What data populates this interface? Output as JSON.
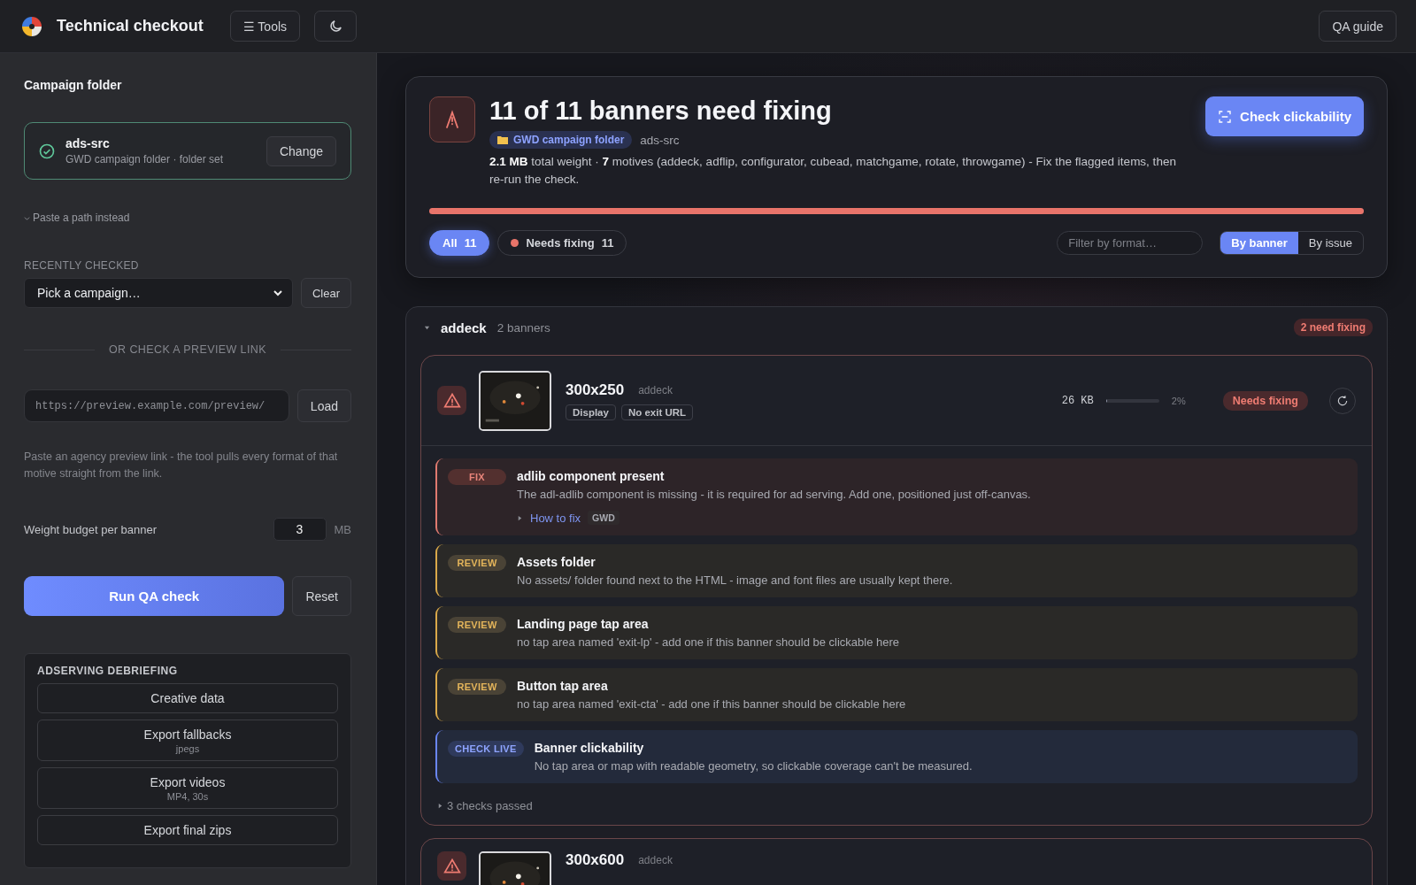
{
  "header": {
    "title": "Technical checkout",
    "tools_button": "☰ Tools",
    "guide_button": "QA guide"
  },
  "sidebar": {
    "folder_heading": "Campaign folder",
    "folder": {
      "name": "ads-src",
      "detail": "GWD campaign folder · folder set",
      "ok": true,
      "change_button": "Change"
    },
    "paste_link": "Paste a path instead",
    "recent_label": "RECENTLY CHECKED",
    "recent_select": "Pick a campaign…",
    "clear_button": "Clear",
    "divider_label": "OR CHECK A PREVIEW LINK",
    "url_placeholder": "https://preview.example.com/preview/",
    "load_button": "Load",
    "help": "Paste an agency preview link - the tool pulls every format of that motive straight from the link.",
    "budget_label": "Weight budget per banner",
    "budget_value": "3",
    "budget_unit": "MB",
    "run_button": "Run QA check",
    "reset_button": "Reset",
    "debrief": {
      "heading": "ADSERVING DEBRIEFING",
      "buttons": [
        {
          "label": "Creative data"
        },
        {
          "label": "Export fallbacks",
          "sub": "jpegs"
        },
        {
          "label": "Export videos",
          "sub": "MP4, 30s"
        },
        {
          "label": "Export final zips"
        }
      ]
    }
  },
  "summary": {
    "title": "11 of 11 banners need fixing",
    "folder_tag": "GWD campaign folder",
    "source": "ads-src",
    "text": "**2.1 MB** total weight · **7** motives (addeck, adflip, configurator, cubead, matchgame, rotate, throwgame) - Fix the flagged items, then re-run the check.",
    "check_button": "Check clickability",
    "progress": {
      "level": 1
    },
    "filters": [
      {
        "label": "All",
        "count": "11",
        "selected": true
      },
      {
        "label": "Needs fixing",
        "count": "11",
        "selected": false,
        "color": "#e8746a"
      }
    ],
    "filter_placeholder": "Filter by format…",
    "views": [
      {
        "label": "By banner",
        "selected": true
      },
      {
        "label": "By issue",
        "selected": false
      }
    ]
  },
  "groups": [
    {
      "name": "addeck",
      "count": "2 banners",
      "badge": "2 need fixing",
      "expanded": true,
      "banners": [
        {
          "size": "300x250",
          "motive": "addeck",
          "tags": [
            "Display",
            "No exit URL"
          ],
          "weight": "26 KB",
          "level": 0.02,
          "percent": "2%",
          "status": "Needs fixing",
          "expanded": true,
          "issues": [
            {
              "kind": "fix",
              "label": "FIX",
              "title": "adlib component present",
              "text": "The adl-adlib component is missing - it is required for ad serving. Add one, positioned just off-canvas.",
              "how_to": "How to fix",
              "tag": "GWD"
            },
            {
              "kind": "review",
              "label": "REVIEW",
              "title": "Assets folder",
              "text": "No assets/ folder found next to the HTML - image and font files are usually kept there."
            },
            {
              "kind": "review",
              "label": "REVIEW",
              "title": "Landing page tap area",
              "text": "no tap area named 'exit-lp' - add one if this banner should be clickable here"
            },
            {
              "kind": "review",
              "label": "REVIEW",
              "title": "Button tap area",
              "text": "no tap area named 'exit-cta' - add one if this banner should be clickable here"
            },
            {
              "kind": "live",
              "label": "CHECK LIVE",
              "title": "Banner clickability",
              "text": "No tap area or map with readable geometry, so clickable coverage can't be measured."
            }
          ],
          "passed": "3 checks passed"
        },
        {
          "size": "300x600",
          "motive": "addeck",
          "expanded": false
        }
      ]
    }
  ]
}
